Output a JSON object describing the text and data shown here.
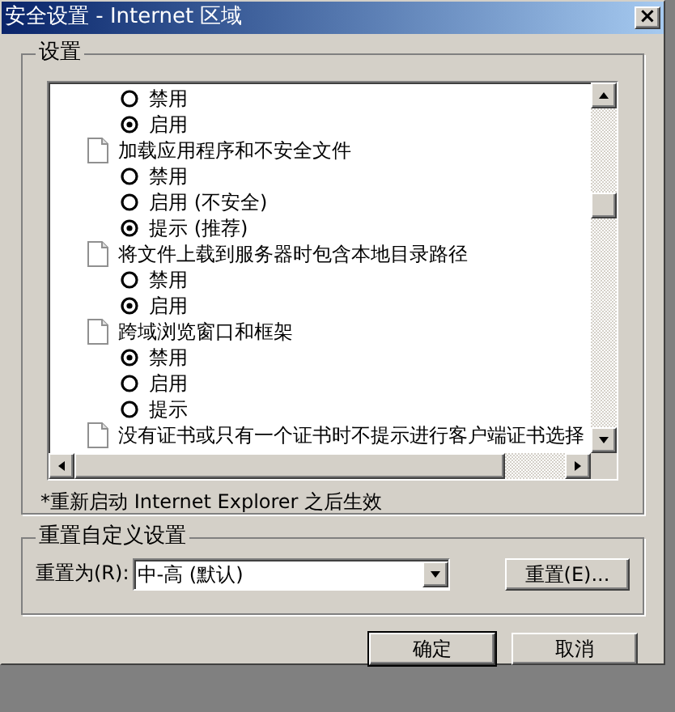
{
  "window": {
    "title": "安全设置 - Internet 区域",
    "close": "×"
  },
  "settings_group": {
    "title": "设置",
    "items": [
      {
        "kind": "option",
        "label": "禁用",
        "selected": false
      },
      {
        "kind": "option",
        "label": "启用",
        "selected": true
      },
      {
        "kind": "setting",
        "label": "加载应用程序和不安全文件"
      },
      {
        "kind": "option",
        "label": "禁用",
        "selected": false
      },
      {
        "kind": "option",
        "label": "启用 (不安全)",
        "selected": false
      },
      {
        "kind": "option",
        "label": "提示 (推荐)",
        "selected": true
      },
      {
        "kind": "setting",
        "label": "将文件上载到服务器时包含本地目录路径"
      },
      {
        "kind": "option",
        "label": "禁用",
        "selected": false
      },
      {
        "kind": "option",
        "label": "启用",
        "selected": true
      },
      {
        "kind": "setting",
        "label": "跨域浏览窗口和框架"
      },
      {
        "kind": "option",
        "label": "禁用",
        "selected": true
      },
      {
        "kind": "option",
        "label": "启用",
        "selected": false
      },
      {
        "kind": "option",
        "label": "提示",
        "selected": false
      },
      {
        "kind": "setting",
        "label": "没有证书或只有一个证书时不提示进行客户端证书选择"
      }
    ],
    "note": "*重新启动 Internet Explorer 之后生效"
  },
  "reset_group": {
    "title": "重置自定义设置",
    "label": "重置为(R):",
    "value": "中-高 (默认)",
    "button": "重置(E)..."
  },
  "buttons": [
    "确定",
    "取消"
  ]
}
